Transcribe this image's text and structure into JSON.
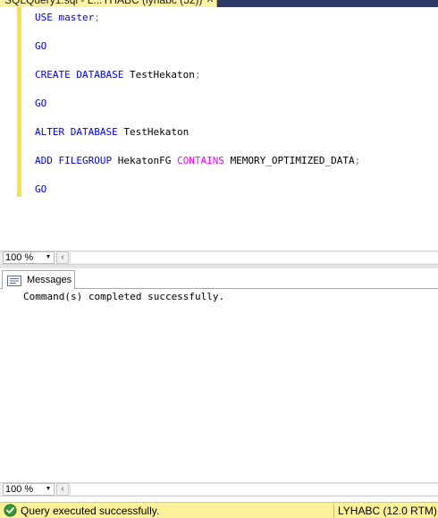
{
  "tab": {
    "title": "SQLQuery1.sql - L...YHABC (lyhabc (52))",
    "close_icon": "close-icon"
  },
  "editor": {
    "lines": [
      {
        "kw": "USE",
        "rest": "master",
        "punct": ";"
      },
      {
        "kw": "GO"
      },
      {
        "kw": "CREATE DATABASE",
        "rest": "TestHekaton",
        "punct": ";"
      },
      {
        "kw": "GO"
      },
      {
        "kw": "ALTER DATABASE",
        "rest": "TestHekaton"
      },
      {
        "kw": "ADD FILEGROUP",
        "rest": "HekatonFG",
        "kw2": "CONTAINS",
        "rest2": "MEMORY_OPTIMIZED_DATA",
        "punct": ";"
      },
      {
        "kw": "GO"
      }
    ],
    "colors": {
      "keyword": "#0000ff",
      "keyword_pink": "#ff00ff",
      "punct": "#808080",
      "change_bar": "#f2e34a"
    }
  },
  "editor_zoom": {
    "value": "100 %",
    "arrow_icon": "dropdown-arrow-icon"
  },
  "results": {
    "messages_tab_label": "Messages",
    "message": "Command(s) completed successfully."
  },
  "results_zoom": {
    "value": "100 %"
  },
  "status": {
    "icon": "success-check-icon",
    "text": "Query executed successfully.",
    "server": "LYHABC (12.0 RTM)",
    "bg_color": "#fdf29a"
  }
}
